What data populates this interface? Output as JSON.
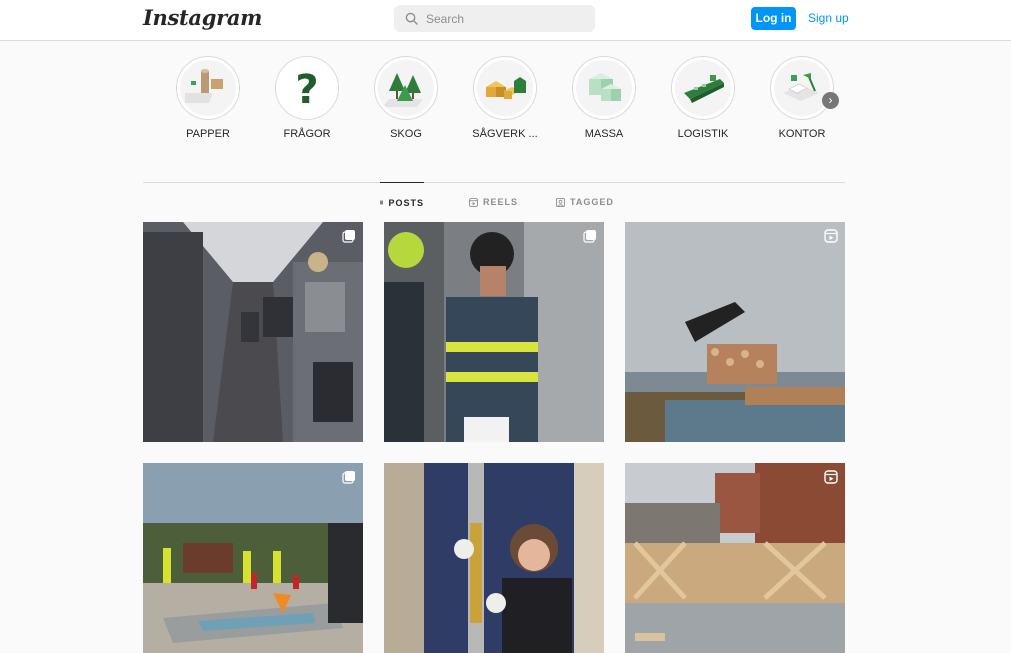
{
  "header": {
    "logo": "Instagram",
    "search_placeholder": "Search",
    "login_label": "Log in",
    "signup_label": "Sign up"
  },
  "highlights": [
    {
      "label": "PAPPER",
      "icon": "paper-rolls-icon"
    },
    {
      "label": "FRÅGOR",
      "icon": "question-mark-icon"
    },
    {
      "label": "SKOG",
      "icon": "forest-icon"
    },
    {
      "label": "SÅGVERK ...",
      "icon": "sawmill-icon"
    },
    {
      "label": "MASSA",
      "icon": "pulp-icon"
    },
    {
      "label": "LOGISTIK",
      "icon": "ship-icon"
    },
    {
      "label": "KONTOR",
      "icon": "office-icon"
    }
  ],
  "tabs": {
    "posts": "POSTS",
    "reels": "REELS",
    "tagged": "TAGGED"
  },
  "posts": [
    {
      "badge": "multiple-icon"
    },
    {
      "badge": "multiple-icon"
    },
    {
      "badge": "reel-icon"
    },
    {
      "badge": "multiple-icon"
    },
    {
      "badge": ""
    },
    {
      "badge": "reel-icon"
    }
  ],
  "colors": {
    "accent": "#0095f6",
    "border": "#dbdbdb",
    "brand_green": "#2e7d3a"
  }
}
